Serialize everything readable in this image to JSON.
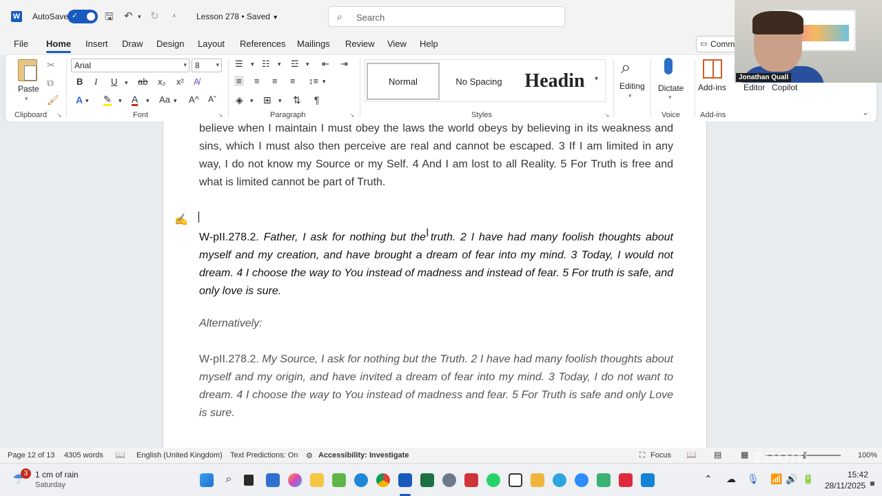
{
  "titlebar": {
    "autosave_label": "AutoSave",
    "doc_title": "Lesson 278 • Saved",
    "search_placeholder": "Search"
  },
  "menu": {
    "tabs": [
      "File",
      "Home",
      "Insert",
      "Draw",
      "Design",
      "Layout",
      "References",
      "Mailings",
      "Review",
      "View",
      "Help"
    ],
    "active_tab": "Home",
    "comments_label": "Comm"
  },
  "ribbon": {
    "clipboard": {
      "paste_label": "Paste",
      "group_label": "Clipboard"
    },
    "font": {
      "font_name": "Arial",
      "font_size": "8",
      "group_label": "Font"
    },
    "paragraph": {
      "group_label": "Paragraph"
    },
    "styles": {
      "items": [
        "Normal",
        "No Spacing",
        "Headin"
      ],
      "group_label": "Styles"
    },
    "editing_label": "Editing",
    "voice": {
      "dictate_label": "Dictate",
      "group_label": "Voice"
    },
    "addins": {
      "label": "Add-ins",
      "group_label": "Add-ins"
    },
    "editor_label": "Editor",
    "copilot_label": "Copilot"
  },
  "document": {
    "para1": "believe when I maintain I must obey the laws the world obeys by believing in its weakness and sins, which I must also then perceive are real and cannot be escaped. 3 If I am limited in any way, I do not know my Source or my Self. 4 And I am lost to all Reality. 5 For Truth is free and what is limited cannot be part of Truth.",
    "para2_lead": "W-pII.278.2.",
    "para2_body": " Father, I ask for nothing but the truth. 2 I have had many foolish thoughts about myself and my creation, and have brought a dream of fear into my mind. 3 Today, I would not dream. 4 I choose the way to You instead of madness and instead of fear. 5 For truth is safe, and only love is sure.",
    "alt_heading": "Alternatively:",
    "para3_lead": "W-pII.278.2.",
    "para3_body": " My Source, I ask for nothing but the Truth. 2 I have had many foolish thoughts about myself and my origin, and have invited a dream of fear into my mind. 3 Today, I do not want to dream. 4 I choose the way to You instead of madness and fear. 5 For Truth is safe and only Love is sure."
  },
  "statusbar": {
    "page": "Page 12 of 13",
    "words": "4305 words",
    "language": "English (United Kingdom)",
    "predictions": "Text Predictions: On",
    "accessibility": "Accessibility: Investigate",
    "focus": "Focus",
    "zoom": "100%"
  },
  "taskbar": {
    "weather_badge": "3",
    "weather_title": "1 cm of rain",
    "weather_sub": "Saturday",
    "time": "15:42",
    "date": "28/11/2025"
  },
  "webcam": {
    "name": "Jonathan Quall"
  },
  "colors": {
    "accent": "#185abd",
    "page_bg": "#ffffff",
    "canvas_bg": "#e9ecef"
  }
}
